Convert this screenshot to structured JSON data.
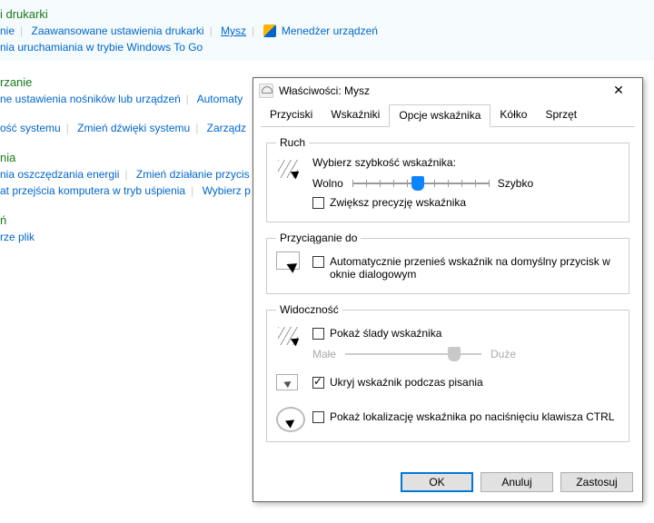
{
  "bg": {
    "sec1_title": "i drukarki",
    "sec1_l1a": "nie",
    "sec1_l1b": "Zaawansowane ustawienia drukarki",
    "sec1_l1c": "Mysz",
    "sec1_l1d": "Menedżer urządzeń",
    "sec1_l2": "nia uruchamiania w trybie Windows To Go",
    "sec2_title": "rzanie",
    "sec2_l1a": "ne ustawienia nośników lub urządzeń",
    "sec2_l1b": "Automaty",
    "sec3_l1a": "ość systemu",
    "sec3_l1b": "Zmień dźwięki systemu",
    "sec3_l1c": "Zarządz",
    "sec4_title": "nia",
    "sec4_l1a": "nia oszczędzania energii",
    "sec4_l1b": "Zmień działanie przycis",
    "sec4_l2a": "at przejścia komputera w tryb uśpienia",
    "sec4_l2b": "Wybierz p",
    "sec5_title": "ń",
    "sec5_l1": "rze plik"
  },
  "dialog": {
    "title": "Właściwości: Mysz",
    "tabs": [
      "Przyciski",
      "Wskaźniki",
      "Opcje wskaźnika",
      "Kółko",
      "Sprzęt"
    ],
    "active_tab": 2,
    "ruch": {
      "legend": "Ruch",
      "label": "Wybierz szybkość wskaźnika:",
      "slow": "Wolno",
      "fast": "Szybko",
      "value_pct": 48,
      "precision": "Zwiększ precyzję wskaźnika",
      "precision_checked": false
    },
    "snap": {
      "legend": "Przyciąganie do",
      "text": "Automatycznie przenieś wskaźnik na domyślny przycisk w oknie dialogowym",
      "checked": false
    },
    "vis": {
      "legend": "Widoczność",
      "trails": "Pokaż ślady wskaźnika",
      "trails_checked": false,
      "small": "Małe",
      "large": "Duże",
      "trail_pct": 80,
      "hide": "Ukryj wskaźnik podczas pisania",
      "hide_checked": true,
      "ctrl": "Pokaż lokalizację wskaźnika po naciśnięciu klawisza CTRL",
      "ctrl_checked": false
    },
    "buttons": {
      "ok": "OK",
      "cancel": "Anuluj",
      "apply": "Zastosuj"
    }
  }
}
